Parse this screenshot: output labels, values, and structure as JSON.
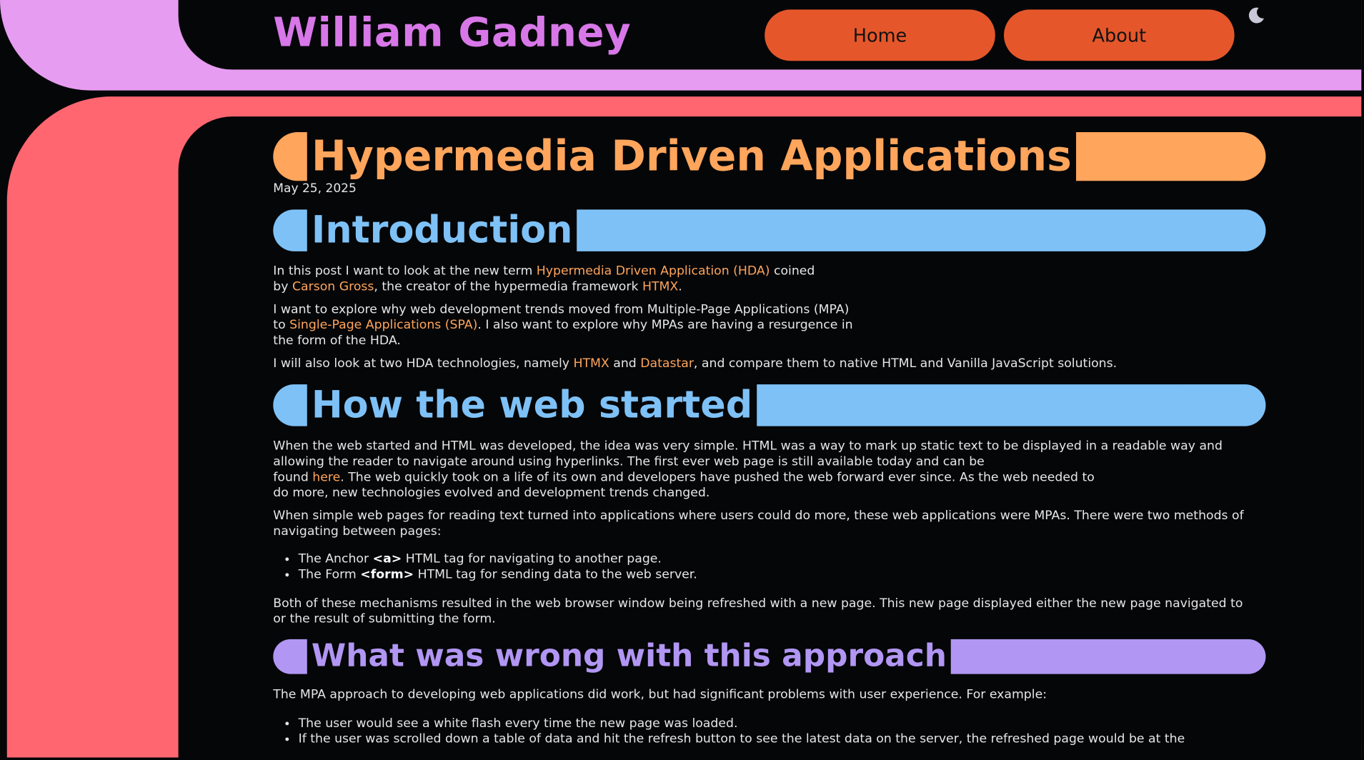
{
  "header": {
    "site_title": "William Gadney",
    "nav": [
      {
        "label": "Home"
      },
      {
        "label": "About"
      }
    ],
    "theme_toggle_icon": "moon-icon"
  },
  "colors": {
    "frame_top": "#e69cf0",
    "frame_side": "#ff6670",
    "nav_button": "#e5572a",
    "title_orange": "#ffa55c",
    "heading_blue": "#7ec1f6",
    "heading_purple": "#b196f3",
    "background": "#050608"
  },
  "article": {
    "title": "Hypermedia Driven Applications",
    "date": "May 25, 2025",
    "sections": {
      "intro": {
        "heading": "Introduction",
        "p1": {
          "t1": "In this post I want to look at the new term ",
          "link1": "Hypermedia Driven Application (HDA)",
          "t2": " coined",
          "t3": "by ",
          "link2": "Carson Gross",
          "t4": ", the creator of the hypermedia framework ",
          "link3": "HTMX",
          "t5": "."
        },
        "p2": {
          "t1": "I want to explore why web development trends moved from Multiple-Page Applications (MPA)",
          "t2": "to ",
          "link1": "Single-Page Applications (SPA)",
          "t3": ". I also want to explore why MPAs are having a resurgence in",
          "t4": "the form of the HDA."
        },
        "p3": {
          "t1": "I will also look at two HDA technologies, namely ",
          "link1": "HTMX",
          "t2": " and ",
          "link2": "Datastar",
          "t3": ", and compare them to native HTML and Vanilla JavaScript solutions."
        }
      },
      "web_started": {
        "heading": "How the web started",
        "p1": {
          "l1": "When the web started and HTML was developed, the idea was very simple. HTML was a way to mark up static text to be displayed in a readable way and",
          "l2": "allowing the reader to navigate around using hyperlinks. The first ever web page is still available today and can be",
          "l3a": "found ",
          "link": "here",
          "l3b": ". The web quickly took on a life of its own and developers have pushed the web forward ever since. As the web needed to",
          "l4": "do more, new technologies evolved and development trends changed."
        },
        "p2": {
          "l1": "When simple web pages for reading text turned into applications where users could do more, these web applications were MPAs. There were two methods of",
          "l2": "navigating between pages:"
        },
        "list": [
          {
            "pre": "The Anchor ",
            "tag": "<a>",
            "post": " HTML tag for navigating to another page."
          },
          {
            "pre": "The Form ",
            "tag": "<form>",
            "post": " HTML tag for sending data to the web server."
          }
        ],
        "p3": {
          "l1": "Both of these mechanisms resulted in the web browser window being refreshed with a new page. This new page displayed either the new page navigated to",
          "l2": "or the result of submitting the form."
        }
      },
      "wrong": {
        "heading": "What was wrong with this approach",
        "p1": "The MPA approach to developing web applications did work, but had significant problems with user experience. For example:",
        "list": [
          "The user would see a white flash every time the new page was loaded.",
          "If the user was scrolled down a table of data and hit the refresh button to see the latest data on the server, the refreshed page would be at the"
        ]
      }
    }
  }
}
